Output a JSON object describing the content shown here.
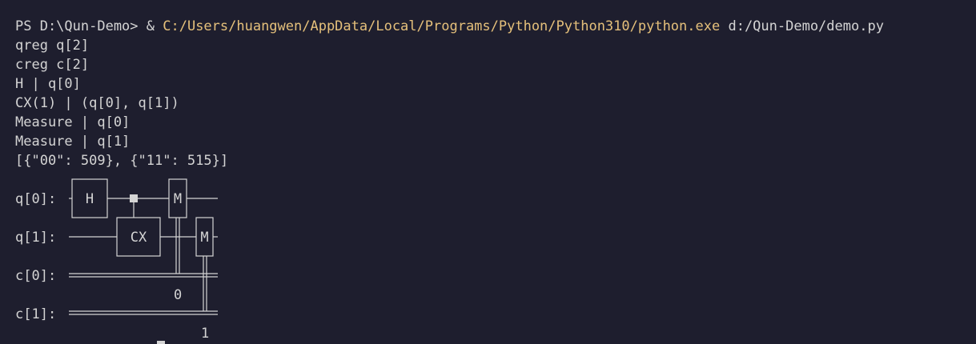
{
  "terminal": {
    "prompt": "PS D:\\Qun-Demo> ",
    "invoke": "& ",
    "python_path": "C:/Users/huangwen/AppData/Local/Programs/Python/Python310/python.exe",
    "script_arg": " d:/Qun-Demo/demo.py",
    "path_color": "#e5c07b",
    "output_lines": [
      "qreg q[2]",
      "creg c[2]",
      "H | q[0]",
      "CX(1) | (q[0], q[1])",
      "Measure | q[0]",
      "Measure | q[1]",
      "[{\"00\": 509}, {\"11\": 515}]"
    ]
  },
  "circuit": {
    "wires": [
      "q[0]:",
      "q[1]:",
      "c[0]:",
      "c[1]:"
    ],
    "gates": {
      "h": "H",
      "cx": "CX",
      "m0": "M",
      "m1": "M"
    },
    "cbit_targets": [
      "0",
      "1"
    ]
  }
}
